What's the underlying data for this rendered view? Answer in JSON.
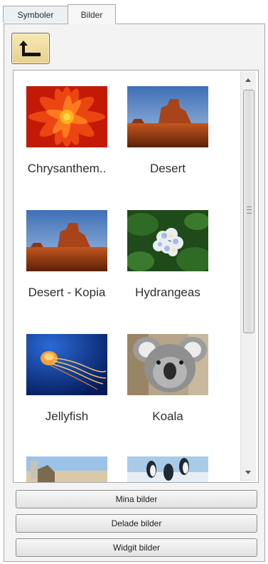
{
  "tabs": [
    {
      "label": "Symboler"
    },
    {
      "label": "Bilder"
    }
  ],
  "toolbar": {
    "up_icon": "folder-up-icon"
  },
  "images": [
    {
      "caption": "Chrysanthem.."
    },
    {
      "caption": "Desert"
    },
    {
      "caption": "Desert - Kopia"
    },
    {
      "caption": "Hydrangeas"
    },
    {
      "caption": "Jellyfish"
    },
    {
      "caption": "Koala"
    },
    {
      "caption": ""
    },
    {
      "caption": ""
    }
  ],
  "buttons": {
    "my_images": "Mina bilder",
    "shared_images": "Delade bilder",
    "widgit_images": "Widgit bilder"
  }
}
